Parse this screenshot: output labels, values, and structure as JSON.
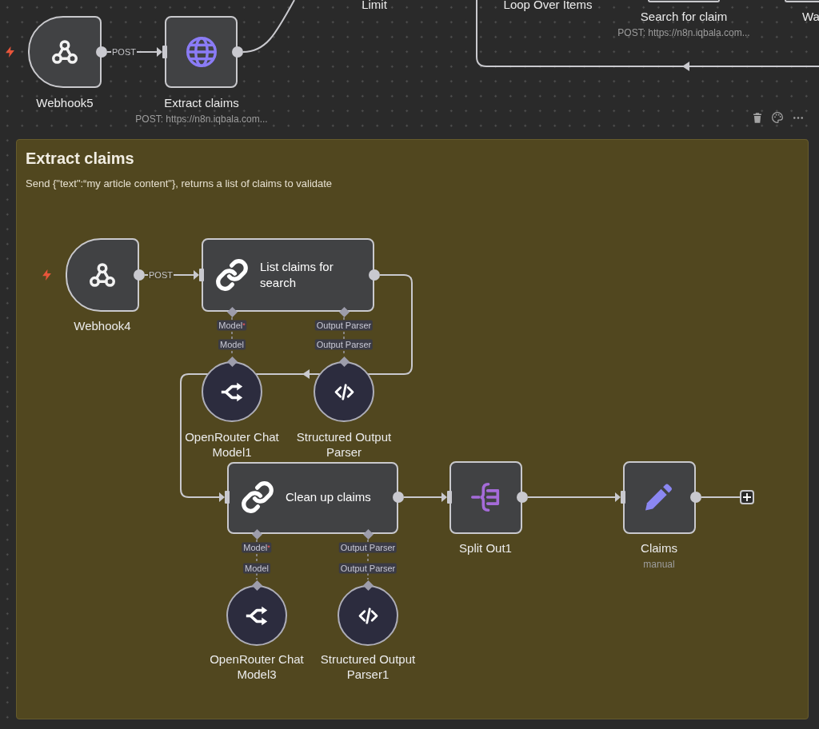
{
  "canvas_nodes": [
    {
      "kind": "webhook",
      "label": "Webhook5"
    },
    {
      "kind": "http",
      "label": "Extract claims",
      "subtitle": "POST: https://n8n.iqbala.com..."
    },
    {
      "kind": "label",
      "label": "Limit"
    },
    {
      "kind": "label",
      "label": "Loop Over Items"
    },
    {
      "kind": "clipped",
      "label": "Search for claim",
      "subtitle": "POST: https://n8n.iqbala.com..."
    },
    {
      "kind": "clipped",
      "label": "Wa"
    }
  ],
  "canvas_edges": [
    {
      "label": "POST"
    }
  ],
  "sticky_note": {
    "title": "Extract claims",
    "text": "Send {\"text\":“my article content\"}, returns a list of claims to validate",
    "nodes": [
      {
        "kind": "webhook",
        "label": "Webhook4"
      },
      {
        "kind": "chain",
        "label": "List claims for search",
        "ports": [
          {
            "label": "Model",
            "mark": "*"
          },
          {
            "label": "Output Parser"
          }
        ]
      },
      {
        "kind": "model",
        "label": "OpenRouter Chat Model1",
        "port": "Model"
      },
      {
        "kind": "parser",
        "label": "Structured Output Parser",
        "port": "Output Parser"
      },
      {
        "kind": "chain",
        "label": "Clean up claims",
        "ports": [
          {
            "label": "Model",
            "mark": "*"
          },
          {
            "label": "Output Parser"
          }
        ]
      },
      {
        "kind": "model",
        "label": "OpenRouter Chat Model3",
        "port": "Model"
      },
      {
        "kind": "parser",
        "label": "Structured Output Parser1",
        "port": "Output Parser"
      },
      {
        "kind": "split",
        "label": "Split Out1"
      },
      {
        "kind": "set",
        "label": "Claims",
        "subtitle": "manual"
      }
    ],
    "edges": [
      {
        "label": "POST"
      }
    ]
  }
}
